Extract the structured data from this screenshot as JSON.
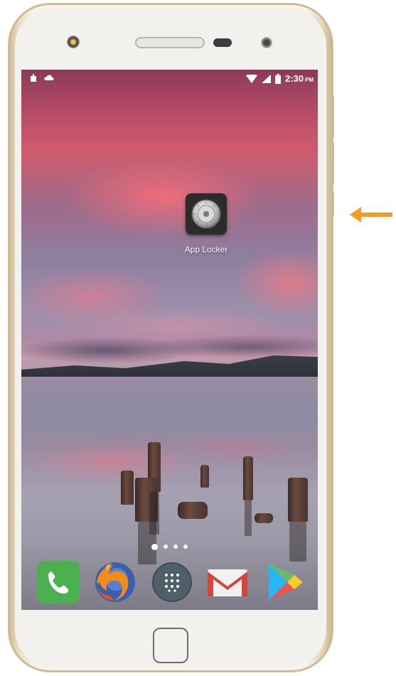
{
  "status_bar": {
    "time": "2:30",
    "ampm": "PM",
    "left_icons": [
      "notification-icon",
      "cloud-icon"
    ],
    "right_icons": [
      "wifi-icon",
      "signal-icon",
      "battery-icon"
    ]
  },
  "home_screen": {
    "apps": [
      {
        "label": "App Locker",
        "icon": "lock-dial-icon"
      }
    ],
    "page_indicator": {
      "pages": 4,
      "current": 1
    }
  },
  "dock": {
    "apps": [
      {
        "icon": "phone-icon"
      },
      {
        "icon": "firefox-icon"
      },
      {
        "icon": "app-drawer-icon"
      },
      {
        "icon": "gmail-icon"
      },
      {
        "icon": "play-store-icon"
      }
    ]
  },
  "annotation": {
    "icon": "arrow-left-icon",
    "color": "#f39a1f"
  },
  "colors": {
    "phone_frame": "#cdbb96",
    "phone_body": "#f3f1ed",
    "dock_phone": "#4caf50",
    "gmail_red": "#d44638"
  }
}
